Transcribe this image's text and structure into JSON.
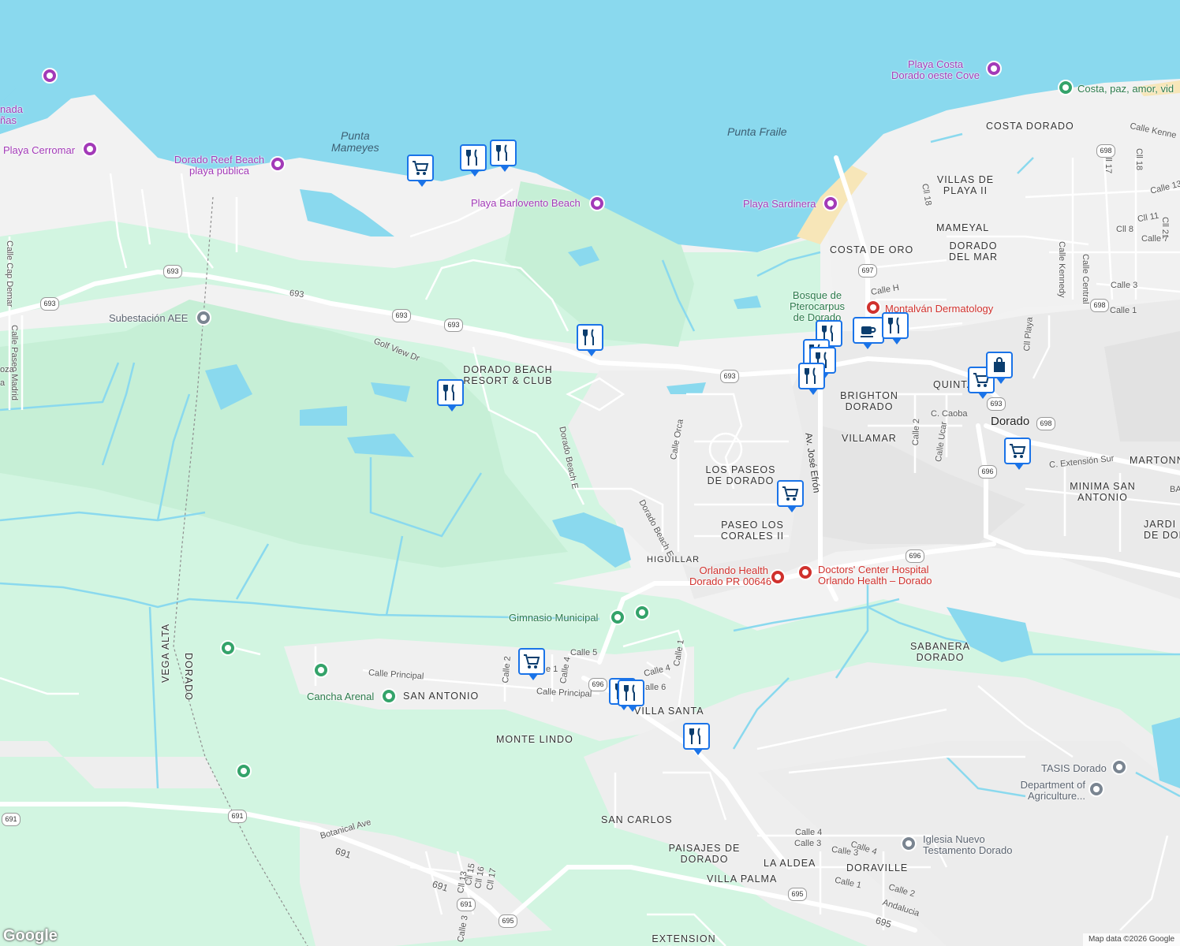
{
  "colors": {
    "water": "#8ad9ee",
    "land": "#f2f2f2",
    "park": "#d2f5e1",
    "green": "#c6efd6",
    "road": "#ffffff",
    "sand": "#f7e6b8",
    "pin_border": "#1a73e8",
    "poi_purple": "#a33ab8",
    "medical": "#d0312d",
    "park_marker": "#34a36a"
  },
  "water_labels": {
    "punta_mameyes": "Punta\nMameyes",
    "punta_fraile": "Punta Fraile"
  },
  "poi": {
    "playa_costa": "Playa Costa\nDorado oeste Cove",
    "playa_cerromar": "Playa Cerromar",
    "dorado_reef": "Dorado Reef Beach\nplaya pública",
    "playa_barlovento": "Playa Barlovento Beach",
    "playa_sardinera": "Playa Sardinera",
    "costa_paz": "Costa, paz, amor, vid",
    "ensenada": "nada\nñas",
    "subestacion": "Subestación AEE",
    "bosque": "Bosque de\nPterocarpus\nde Dorado",
    "montalvan": "Montalván Dermatology",
    "orlando_health": "Orlando Health\nDorado PR 00646",
    "doctors_center": "Doctors' Center Hospital\nOrlando Health – Dorado",
    "gimnasio": "Gimnasio Municipal",
    "cancha": "Cancha Arenal",
    "tasis": "TASIS Dorado",
    "agriculture": "Department of\nAgriculture...",
    "iglesia": "Iglesia Nuevo\nTestamento Dorado"
  },
  "neighborhoods": {
    "costa_dorado": "COSTA DORADO",
    "villas_playa": "VILLAS DE\nPLAYA II",
    "mameyal": "MAMEYAL",
    "costa_oro": "COSTA DE ORO",
    "dorado_mar": "DORADO\nDEL MAR",
    "dorado_beach": "DORADO BEACH\nRESORT & CLUB",
    "brighton": "BRIGHTON\nDORADO",
    "quintas": "QUINTAS",
    "dorado": "Dorado",
    "villamar": "VILLAMAR",
    "martonnel": "MARTONNEL",
    "paseos": "LOS PASEOS\nDE DORADO",
    "minima": "MINIMA SAN\nANTONIO",
    "jardin": "JARDI\nDE DOR",
    "paseo_corales": "PASEO LOS\nCORALES II",
    "higuillar": "HIGUILLAR",
    "sabanera": "SABANERA\nDORADO",
    "san_antonio": "SAN ANTONIO",
    "villa_santa": "VILLA SANTA",
    "monte_lindo": "MONTE LINDO",
    "san_carlos": "SAN CARLOS",
    "paisajes": "PAISAJES DE\nDORADO",
    "la_aldea": "LA ALDEA",
    "doraville": "DORAVILLE",
    "villa_palma": "VILLA PALMA",
    "extension": "EXTENSION\nHIGUILLAR",
    "dorado_vertical": "DORADO",
    "vega_alta": "VEGA ALTA"
  },
  "streets": {
    "calle_kenne": "Calle Kenne",
    "calle_13": "Calle 13",
    "cll_17": "Cll 17",
    "cll_18b": "Cll 18",
    "cll_18": "Cll 18",
    "cll_11": "Cll 11",
    "cll_21": "Cll 21",
    "cll_8": "Cll 8",
    "calle_7": "Calle 7",
    "calle_3": "Calle 3",
    "calle_1": "Calle 1",
    "calle_kennedy": "Calle Kennedy",
    "calle_central": "Calle Central",
    "cll_playa": "Cll Playa",
    "calle_h": "Calle H",
    "c_caoba": "C. Caoba",
    "calle_2": "Calle 2",
    "calle_ucar": "Calle Ucar",
    "c_extension": "C. Extensión Sur",
    "ba": "BA",
    "calle_cap": "Calle Cap Demar",
    "calle_paseo": "Calle Paseo Madrid",
    "oza": "oza",
    "a": "a",
    "golf_view": "Golf View Dr",
    "dorado_beach_e": "Dorado Beach E",
    "dorado_beach_e2": "Dorado Beach E",
    "calle_orca": "Calle Orca",
    "av_jose": "Av. José Efrón",
    "rd_693": "693",
    "calle_5": "Calle 5",
    "calle_principal": "Calle Principal",
    "calle_principal2": "Calle Principal",
    "calle_2b": "Calle 2",
    "e_1": "e 1",
    "calle_4": "Calle 4",
    "calle_4b": "Calle 4",
    "calle_6": "alle 6",
    "calle_1b": "Calle 1",
    "botanical": "Botanical Ave",
    "rd_691": "691",
    "rd_691b": "691",
    "cll_15": "Cll 15",
    "cll_16": "Cll 16",
    "cll_17b": "Cll 17",
    "cll_13": "Cll 13",
    "calle_3b": "Calle 3",
    "calle_4c": "Calle 4",
    "calle_3c": "Calle 3",
    "calle_3d": "Calle 3",
    "calle_4d": "Calle 4",
    "calle_1c": "Calle 1",
    "calle_2c": "Calle 2",
    "andalucia": "Andalucia",
    "rd_695": "695"
  },
  "shields": {
    "s693a": "693",
    "s693b": "693",
    "s693c": "693",
    "s693d": "693",
    "s693e": "693",
    "s693f": "693",
    "s698a": "698",
    "s698b": "698",
    "s698c": "698",
    "s697": "697",
    "s696a": "696",
    "s696b": "696",
    "s696c": "696",
    "s691a": "691",
    "s691b": "691",
    "s691c": "691",
    "s695": "695"
  },
  "google_logo": "Google",
  "attribution": "Map data ©2026 Google"
}
